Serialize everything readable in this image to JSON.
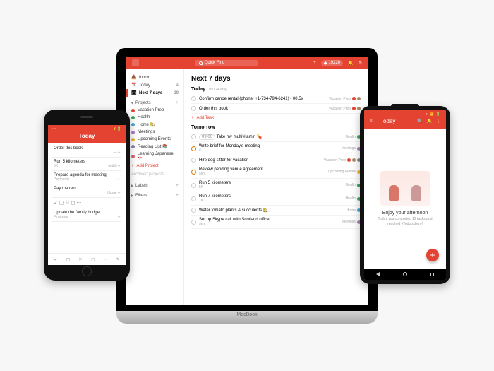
{
  "brand_color": "#e44332",
  "laptop": {
    "search_placeholder": "Quick Find",
    "points": "19220",
    "sidebar": {
      "inbox": "Inbox",
      "today": "Today",
      "today_count": "4",
      "next7": "Next 7 days",
      "next7_count": "29",
      "projects_label": "Projects",
      "projects": [
        {
          "name": "Vacation Prep",
          "color": "#e44332"
        },
        {
          "name": "Health",
          "color": "#3aa75a"
        },
        {
          "name": "Home",
          "color": "#4aa3df",
          "emoji": "🏡"
        },
        {
          "name": "Meetings",
          "color": "#b07cc6"
        },
        {
          "name": "Upcoming Events",
          "color": "#f0b429"
        },
        {
          "name": "Reading List",
          "color": "#8e7cc3",
          "emoji": "📚"
        },
        {
          "name": "Learning Japanese",
          "color": "#d96c6c",
          "emoji": "🎌"
        }
      ],
      "add_project": "Add Project",
      "archived": "Archived projects",
      "labels": "Labels",
      "filters": "Filters"
    },
    "main": {
      "title": "Next 7 days",
      "today_label": "Today",
      "today_date": "Thu 24 May",
      "tomorrow_label": "Tomorrow",
      "add_task": "Add Task",
      "tasks_today": [
        {
          "text": "Confirm canoe rental (phone: +1-734-794-6241) - 00.5x",
          "tag": "Vacation Prep",
          "color": "#e44332",
          "avatar": true
        },
        {
          "text": "Order this book",
          "tag": "Vacation Prep",
          "color": "#e44332",
          "avatar": true
        }
      ],
      "tasks_tomorrow": [
        {
          "time": "09:00",
          "text": "Take my multivitamin",
          "emoji": "💊",
          "tag": "Health",
          "color": "#3aa75a"
        },
        {
          "text": "Write brief for Monday's meeting",
          "sub": "#",
          "tag": "Meetings",
          "color": "#b07cc6",
          "accent": true
        },
        {
          "text": "Hire dog-sitter for vacation",
          "tag": "Vacation Prep",
          "color": "#e44332",
          "avatar": true,
          "extra": true
        },
        {
          "text": "Review pending venue agreement",
          "sub": "sent",
          "tag": "Upcoming Events",
          "color": "#f0b429",
          "accent": true
        },
        {
          "text": "Run 5 kilometers",
          "sub": "5K",
          "tag": "Health",
          "color": "#3aa75a"
        },
        {
          "text": "Run 7 kilometers",
          "sub": "7K",
          "tag": "Health",
          "color": "#3aa75a"
        },
        {
          "text": "Water tomato plants & succulents",
          "tag": "Home",
          "color": "#4aa3df",
          "emoji": "🏡"
        },
        {
          "text": "Set up Skype call with Scotland office",
          "sub": "sent",
          "tag": "Meetings",
          "color": "#b07cc6"
        }
      ]
    }
  },
  "iphone": {
    "title": "Today",
    "tasks": [
      {
        "text": "Order this book",
        "sub": "",
        "meta": "— ●"
      },
      {
        "text": "Run 5 kilometers",
        "sub": "5K",
        "meta": "Health ●"
      },
      {
        "text": "Prepare agenda for meeting",
        "sub": "Payments",
        "meta": "✓"
      },
      {
        "text": "Pay the rent",
        "sub": "",
        "meta": "Home ●"
      },
      {
        "divider_icons": true
      },
      {
        "text": "Update the family budget",
        "sub": "Finances",
        "meta": "●"
      }
    ]
  },
  "android": {
    "title": "Today",
    "empty_title": "Enjoy your afternoon",
    "empty_sub": "Today you completed 12 tasks and reached #TodoistZero!"
  }
}
